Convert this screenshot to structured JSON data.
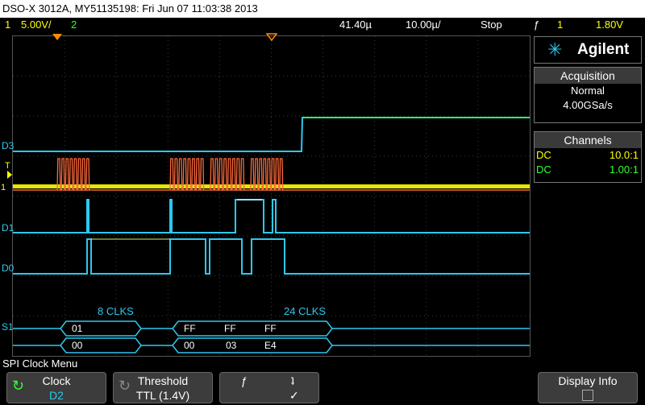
{
  "title": "DSO-X 3012A, MY51135198: Fri Jun 07 11:03:38 2013",
  "status": {
    "ch1_num": "1",
    "ch1_scale": "5.00V/",
    "ch2_num": "2",
    "delay": "41.40µ",
    "timebase": "10.00µ/",
    "run_state": "Stop",
    "trig_icon": "ƒ",
    "trig_src": "1",
    "trig_level": "1.80V"
  },
  "brand": {
    "name": "Agilent"
  },
  "acquisition": {
    "header": "Acquisition",
    "mode": "Normal",
    "rate": "4.00GSa/s"
  },
  "channels": {
    "header": "Channels",
    "rows": [
      {
        "coupling": "DC",
        "ratio": "10.0:1",
        "color": "#ffff00"
      },
      {
        "coupling": "DC",
        "ratio": "1.00:1",
        "color": "#33ff33"
      }
    ]
  },
  "waveform_labels": {
    "d3": "D3",
    "t": "T",
    "d1": "D1",
    "d0": "D0",
    "s1": "S1",
    "clks_left": "8 CLKS",
    "clks_right": "24 CLKS",
    "mosi": [
      "01",
      "FF",
      "FF",
      "FF"
    ],
    "miso": [
      "00",
      "00",
      "03",
      "E4"
    ]
  },
  "menu": {
    "title": "SPI Clock Menu",
    "softkeys": [
      {
        "label": "Clock",
        "value": "D2"
      },
      {
        "label": "Threshold",
        "value": "TTL (1.4V)"
      },
      {
        "label": "ƒ",
        "value": "ʇ"
      },
      {
        "label": "Display Info",
        "value": ""
      }
    ],
    "edge_check": "✓"
  },
  "colors": {
    "digital": "#2ec8f0",
    "clock": "#ff6a3a",
    "analog1": "#ffff00",
    "analog2": "#33ff33",
    "marker": "#ff8c00"
  }
}
